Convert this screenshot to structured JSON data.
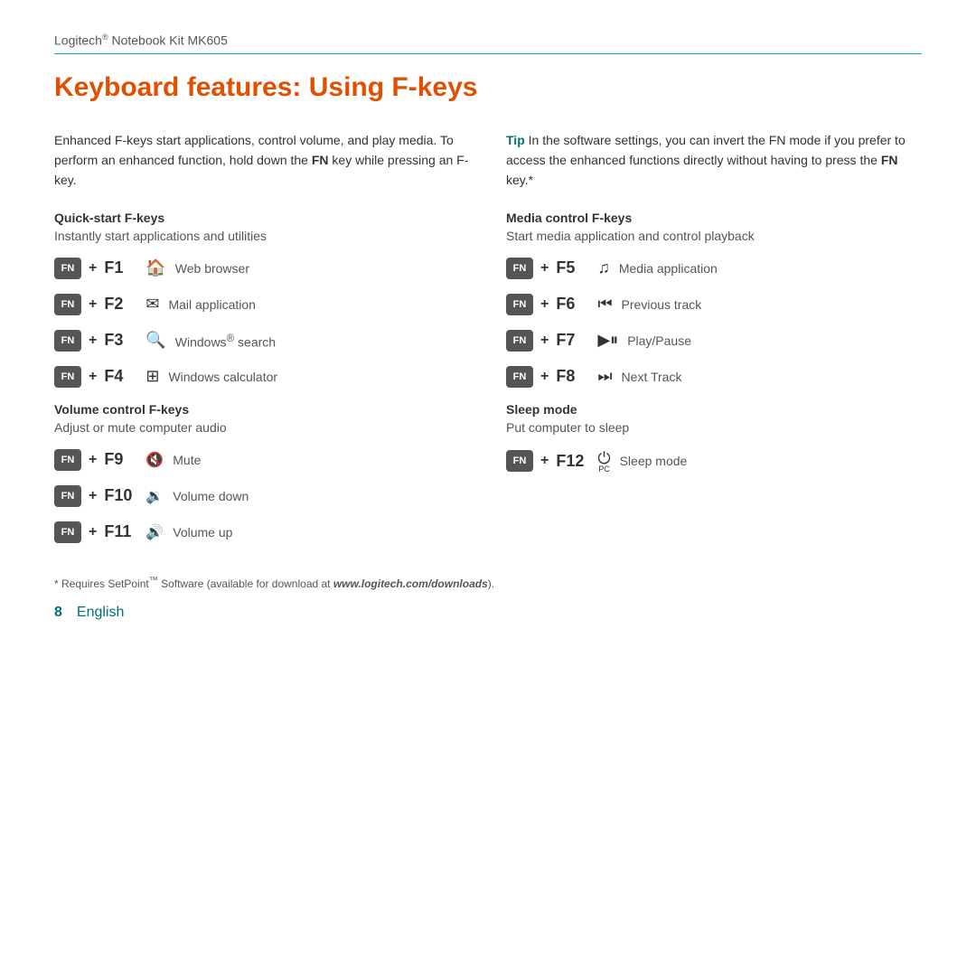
{
  "header": {
    "title": "Logitech",
    "title_sup": "®",
    "subtitle": " Notebook Kit MK605"
  },
  "page_title": "Keyboard features: Using F-keys",
  "left_col": {
    "intro": {
      "text_before": "Enhanced F-keys start applications, control volume, and play media. To perform an enhanced function, hold down the ",
      "bold": "FN",
      "text_after": " key while pressing an F-key."
    },
    "quick_start": {
      "header": "Quick-start F-keys",
      "subtext": "Instantly start applications and utilities",
      "keys": [
        {
          "fn": "FN",
          "plus": "+",
          "fkey": "F1",
          "icon": "🏠",
          "description": "Web browser"
        },
        {
          "fn": "FN",
          "plus": "+",
          "fkey": "F2",
          "icon": "✉",
          "description": "Mail application"
        },
        {
          "fn": "FN",
          "plus": "+",
          "fkey": "F3",
          "icon": "🔍",
          "description": "Windows® search"
        },
        {
          "fn": "FN",
          "plus": "+",
          "fkey": "F4",
          "icon": "⊞",
          "description": "Windows calculator"
        }
      ]
    },
    "volume_control": {
      "header": "Volume control F-keys",
      "subtext": "Adjust or mute computer audio",
      "keys": [
        {
          "fn": "FN",
          "plus": "+",
          "fkey": "F9",
          "icon": "🔇",
          "description": "Mute"
        },
        {
          "fn": "FN",
          "plus": "+",
          "fkey": "F10",
          "icon": "🔉",
          "description": "Volume down"
        },
        {
          "fn": "FN",
          "plus": "+",
          "fkey": "F11",
          "icon": "🔊",
          "description": "Volume up"
        }
      ]
    }
  },
  "right_col": {
    "tip": {
      "label": "Tip",
      "text": " In the software settings, you can invert the FN mode if you prefer to access the enhanced functions directly without having to press the ",
      "bold": "FN",
      "text_after": " key.*"
    },
    "media_control": {
      "header": "Media control F-keys",
      "subtext": "Start media application and control playback",
      "keys": [
        {
          "fn": "FN",
          "plus": "+",
          "fkey": "F5",
          "icon": "♫",
          "description": "Media application"
        },
        {
          "fn": "FN",
          "plus": "+",
          "fkey": "F6",
          "icon": "⏮",
          "description": "Previous track"
        },
        {
          "fn": "FN",
          "plus": "+",
          "fkey": "F7",
          "icon": "▶⏸",
          "description": "Play/Pause"
        },
        {
          "fn": "FN",
          "plus": "+",
          "fkey": "F8",
          "icon": "⏭",
          "description": "Next Track"
        }
      ]
    },
    "sleep_mode": {
      "header": "Sleep mode",
      "subtext": "Put computer to sleep",
      "keys": [
        {
          "fn": "FN",
          "plus": "+",
          "fkey": "F12",
          "icon": "⏻",
          "sub": "PC",
          "description": "Sleep mode"
        }
      ]
    }
  },
  "footer": {
    "note_before": "* Requires SetPoint",
    "note_tm": "™",
    "note_after": " Software (available for download at ",
    "note_link": "www.logitech.com/downloads",
    "note_end": ").",
    "page_number": "8",
    "language": "English"
  }
}
